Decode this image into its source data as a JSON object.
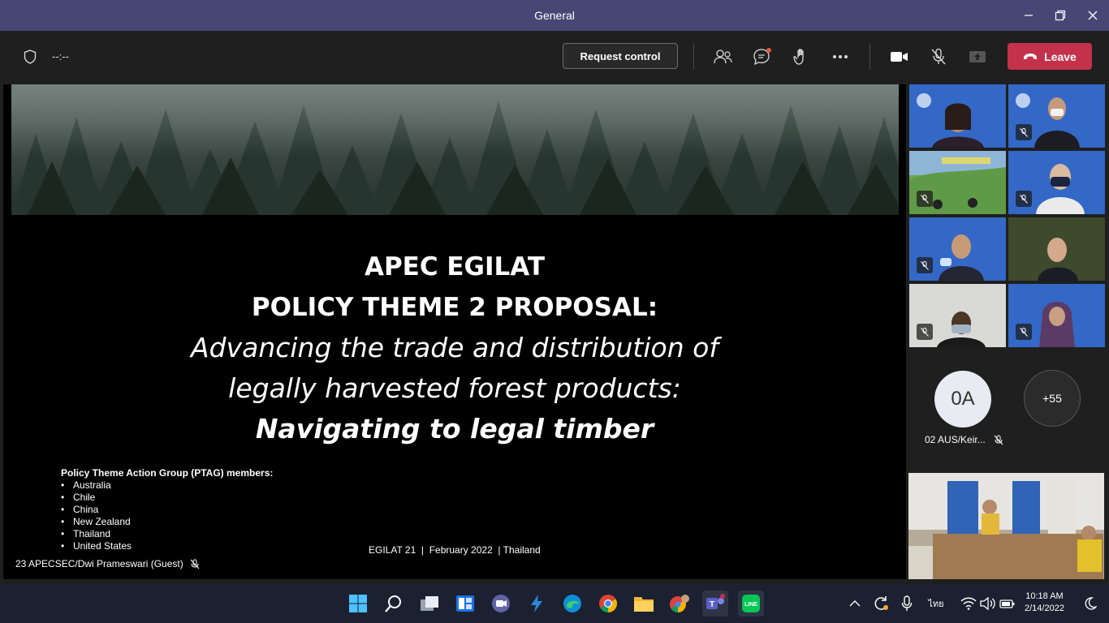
{
  "window": {
    "title": "General"
  },
  "toolbar": {
    "timer": "--:--",
    "request_control_label": "Request control",
    "leave_label": "Leave"
  },
  "slide": {
    "title_line1": "APEC EGILAT",
    "title_line2": "POLICY THEME 2 PROPOSAL:",
    "subtitle_line1": "Advancing the trade and distribution of",
    "subtitle_line2": "legally harvested forest products:",
    "subtitle_line3": "Navigating to legal timber",
    "members_heading": "Policy Theme Action Group (PTAG) members:",
    "members": [
      "Australia",
      "Chile",
      "China",
      "New Zealand",
      "Thailand",
      "United States"
    ],
    "footer": "EGILAT 21  |  February 2022  | Thailand"
  },
  "presenter": {
    "name": "23 APECSEC/Dwi Prameswari (Guest)"
  },
  "participants": {
    "avatar_initials": "0A",
    "avatar_name": "02 AUS/Keir...",
    "more_count": "+55"
  },
  "taskbar": {
    "time": "10:18 AM",
    "date": "2/14/2022",
    "language": "ไทย"
  },
  "colors": {
    "titlebar": "#464775",
    "leave": "#c4314b",
    "tile_bg": "#3368c6",
    "taskbar": "#1b2130"
  }
}
